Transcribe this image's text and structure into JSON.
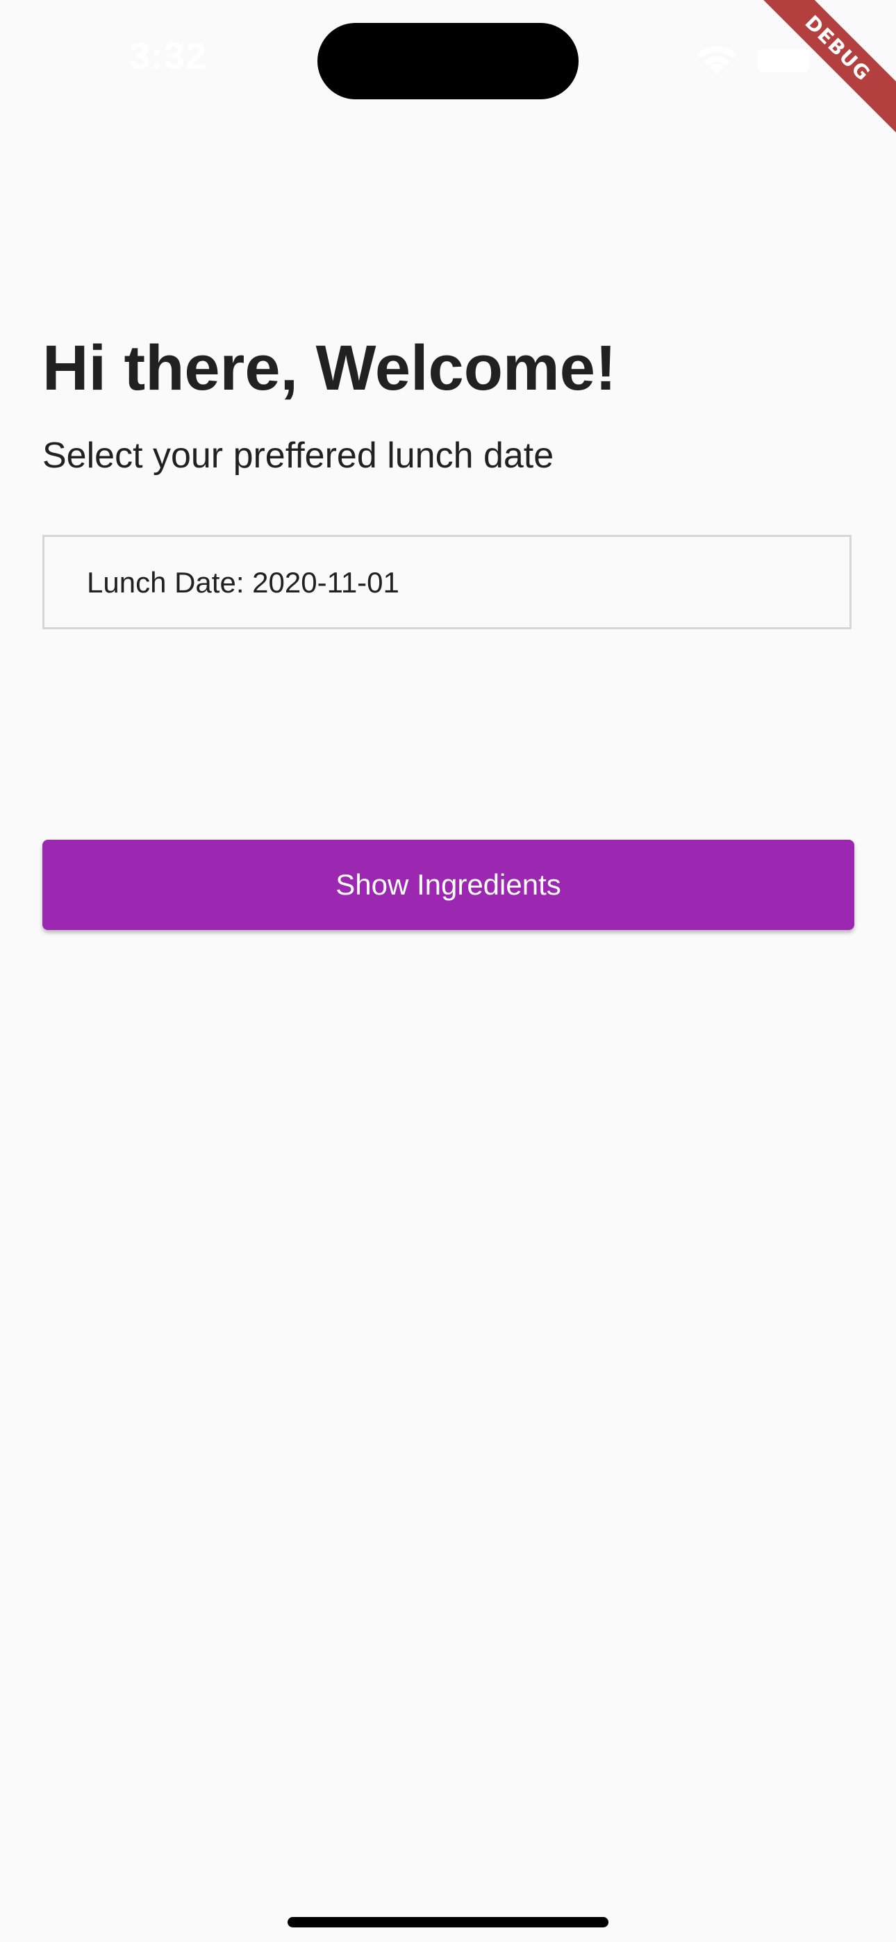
{
  "status_bar": {
    "time": "3:32",
    "wifi_icon": "wifi-icon",
    "battery_icon": "battery-icon"
  },
  "debug_banner": {
    "label": "DEBUG",
    "color": "#B3403E"
  },
  "main": {
    "title": "Hi there, Welcome!",
    "subtitle": "Select your preffered lunch date",
    "date_field": {
      "value": "Lunch Date: 2020-11-01"
    },
    "button": {
      "label": "Show Ingredients",
      "color": "#9C27B0"
    }
  },
  "colors": {
    "background": "#FAFAFA",
    "text": "#212121",
    "field_border": "#D6D6D6"
  }
}
